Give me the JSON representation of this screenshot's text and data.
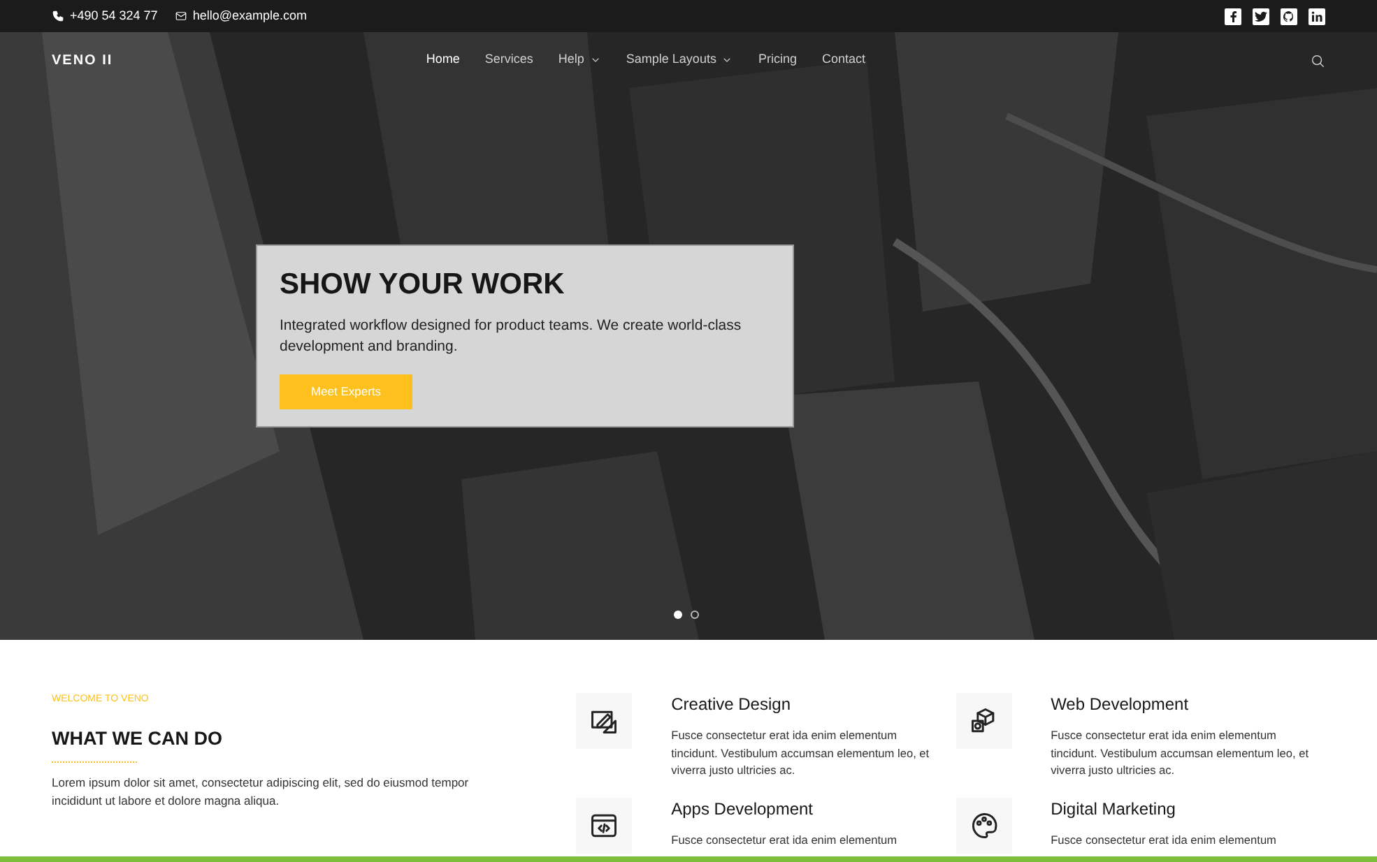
{
  "topbar": {
    "phone": "+490 54 324 77",
    "email": "hello@example.com",
    "social": [
      {
        "kind": "facebook"
      },
      {
        "kind": "twitter"
      },
      {
        "kind": "github"
      },
      {
        "kind": "linkedin"
      }
    ]
  },
  "nav": {
    "logo": "VENO II",
    "items": [
      {
        "label": "Home",
        "selected": true,
        "dropdown": false
      },
      {
        "label": "Services",
        "selected": false,
        "dropdown": false
      },
      {
        "label": "Help",
        "selected": false,
        "dropdown": true
      },
      {
        "label": "Sample Layouts",
        "selected": false,
        "dropdown": true
      },
      {
        "label": "Pricing",
        "selected": false,
        "dropdown": false
      },
      {
        "label": "Contact",
        "selected": false,
        "dropdown": false
      }
    ]
  },
  "hero": {
    "title": "SHOW YOUR WORK",
    "text": "Integrated workflow designed for product teams. We create world-class development and branding.",
    "button": "Meet Experts",
    "dots": [
      {
        "selected": true
      },
      {
        "selected": false
      }
    ]
  },
  "intro": {
    "eyebrow": "WELCOME TO VENO",
    "title": "WHAT WE CAN DO",
    "text": "Lorem ipsum dolor sit amet, consectetur adipiscing elit, sed do eiusmod tempor incididunt ut labore et dolore magna aliqua."
  },
  "services": [
    {
      "kind": "design",
      "title": "Creative Design",
      "text": "Fusce consectetur erat ida enim elementum tincidunt. Vestibulum accumsan elementum leo, et viverra justo ultricies ac."
    },
    {
      "kind": "web",
      "title": "Web Development",
      "text": "Fusce consectetur erat ida enim elementum tincidunt. Vestibulum accumsan elementum leo, et viverra justo ultricies ac."
    },
    {
      "kind": "apps",
      "title": "Apps Development",
      "text": "Fusce consectetur erat ida enim elementum"
    },
    {
      "kind": "marketing",
      "title": "Digital Marketing",
      "text": "Fusce consectetur erat ida enim elementum"
    }
  ]
}
